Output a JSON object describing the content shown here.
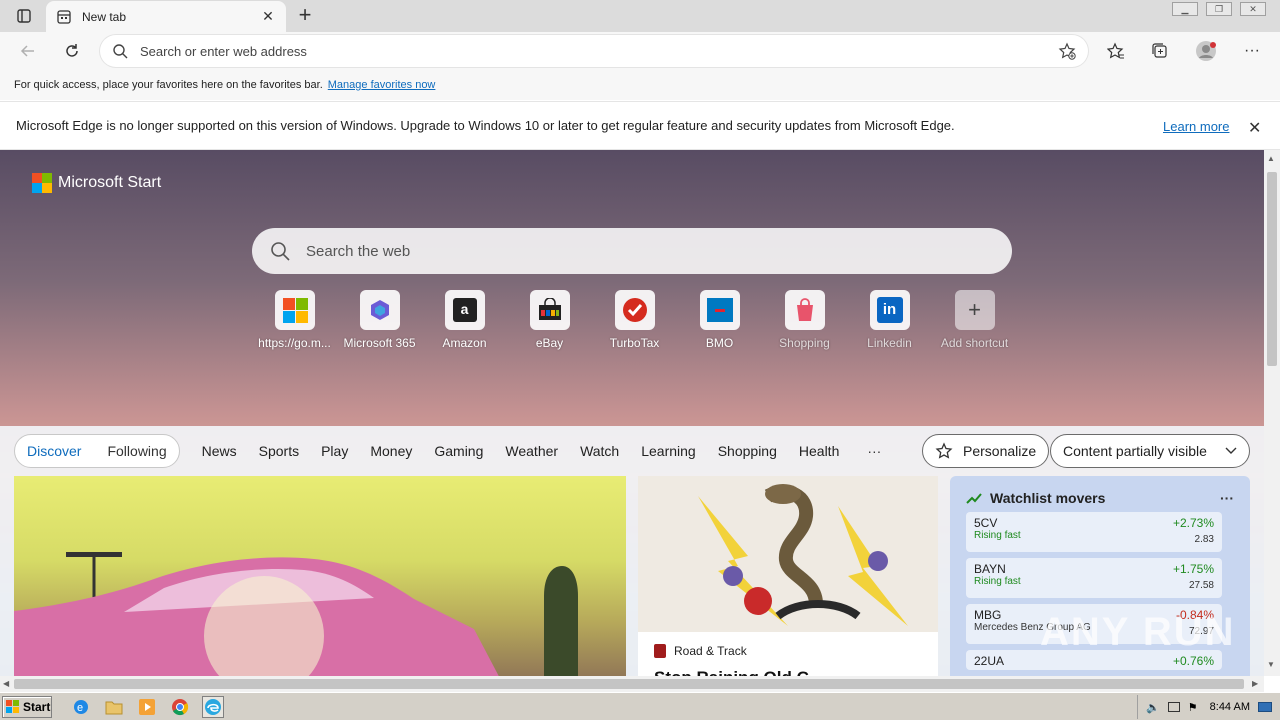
{
  "browser": {
    "tab_title": "New tab",
    "address_placeholder": "Search or enter web address",
    "favorites_hint": "For quick access, place your favorites here on the favorites bar.",
    "favorites_link": "Manage favorites now",
    "info_message": "Microsoft Edge is no longer supported on this version of Windows. Upgrade to Windows 10 or later to get regular feature and security updates from Microsoft Edge.",
    "info_link": "Learn more"
  },
  "page": {
    "brand": "Microsoft Start",
    "search_placeholder": "Search the web",
    "shortcuts": [
      {
        "label": "https://go.m...",
        "icon": "microsoft-icon"
      },
      {
        "label": "Microsoft 365",
        "icon": "m365-icon"
      },
      {
        "label": "Amazon",
        "icon": "amazon-icon"
      },
      {
        "label": "eBay",
        "icon": "ebay-icon"
      },
      {
        "label": "TurboTax",
        "icon": "turbotax-icon"
      },
      {
        "label": "BMO",
        "icon": "bmo-icon"
      },
      {
        "label": "Shopping",
        "icon": "shopping-icon"
      },
      {
        "label": "Linkedin",
        "icon": "linkedin-icon"
      },
      {
        "label": "Add shortcut",
        "icon": "plus-icon"
      }
    ],
    "feed": {
      "primary_tabs": [
        "Discover",
        "Following"
      ],
      "categories": [
        "News",
        "Sports",
        "Play",
        "Money",
        "Gaming",
        "Weather",
        "Watch",
        "Learning",
        "Shopping",
        "Health"
      ],
      "more": "···",
      "personalize": "Personalize",
      "content_setting": "Content partially visible"
    },
    "card_mid": {
      "source": "Road & Track",
      "headline": "Stop Raining Old C..."
    },
    "watchlist": {
      "title": "Watchlist movers",
      "stocks": [
        {
          "symbol": "5CV",
          "sub": "Rising fast",
          "pct": "+2.73%",
          "value": "2.83"
        },
        {
          "symbol": "BAYN",
          "sub": "Rising fast",
          "pct": "+1.75%",
          "value": "27.58"
        },
        {
          "symbol": "MBG",
          "sub": "Mercedes Benz Group AG",
          "pct": "-0.84%",
          "value": "72.97"
        },
        {
          "symbol": "22UA",
          "sub": "",
          "pct": "+0.76%",
          "value": ""
        }
      ]
    },
    "watermark": "ANY RUN"
  },
  "taskbar": {
    "start": "Start",
    "clock": "8:44 AM"
  },
  "colors": {
    "accent": "#0f6cbd",
    "up": "#1f8a1f",
    "down": "#c42b1c"
  }
}
